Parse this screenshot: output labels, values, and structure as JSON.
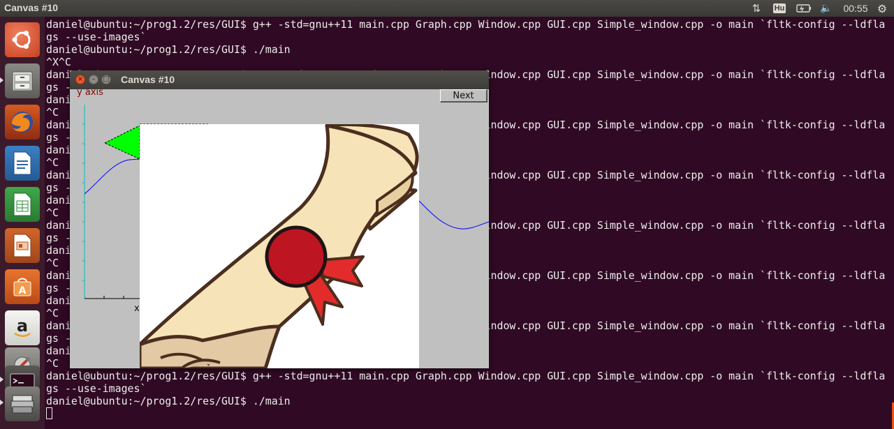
{
  "top_panel": {
    "title": "Canvas #10",
    "keyboard_layout": "Hu",
    "clock": "00:55",
    "icons": [
      "network-icon",
      "keyboard-layout-icon",
      "battery-icon",
      "volume-icon",
      "settings-gear-icon"
    ]
  },
  "launcher": {
    "items": [
      {
        "name": "ubuntu-dash",
        "icon": "ubuntu-logo-icon"
      },
      {
        "name": "files",
        "icon": "file-cabinet-icon"
      },
      {
        "name": "firefox",
        "icon": "firefox-icon"
      },
      {
        "name": "libreoffice-writer",
        "icon": "writer-document-icon"
      },
      {
        "name": "libreoffice-calc",
        "icon": "calc-spreadsheet-icon"
      },
      {
        "name": "libreoffice-impress",
        "icon": "impress-presentation-icon"
      },
      {
        "name": "ubuntu-software",
        "icon": "software-center-icon"
      },
      {
        "name": "amazon",
        "icon": "amazon-icon"
      },
      {
        "name": "system-settings",
        "icon": "settings-wrench-icon"
      },
      {
        "name": "terminal",
        "icon": "terminal-icon"
      },
      {
        "name": "fltk-app",
        "icon": "app-stack-icon"
      }
    ]
  },
  "terminal": {
    "lines": [
      "daniel@ubuntu:~/prog1.2/res/GUI$ g++ -std=gnu++11 main.cpp Graph.cpp Window.cpp GUI.cpp Simple_window.cpp -o main `fltk-config --ldfla",
      "gs --use-images`",
      "daniel@ubuntu:~/prog1.2/res/GUI$ ./main",
      "^X^C",
      "daniel@ubuntu:~/prog1.2/res/GUI$ g++ -std=gnu++11 main.cpp Graph.cpp Window.cpp GUI.cpp Simple_window.cpp -o main `fltk-config --ldfla",
      "gs --use-images`",
      "daniel@ubuntu:~/prog1.2/res/GUI$ ./main",
      "^C",
      "daniel@ubuntu:~/prog1.2/res/GUI$ g++ -std=gnu++11 main.cpp Graph.cpp Window.cpp GUI.cpp Simple_window.cpp -o main `fltk-config --ldfla",
      "gs --use-images`",
      "daniel@ubuntu:~/prog1.2/res/GUI$ ./main",
      "^C",
      "daniel@ubuntu:~/prog1.2/res/GUI$ g++ -std=gnu++11 main.cpp Graph.cpp Window.cpp GUI.cpp Simple_window.cpp -o main `fltk-config --ldfla",
      "gs --use-images`",
      "daniel@ubuntu:~/prog1.2/res/GUI$ ./main",
      "^C",
      "daniel@ubuntu:~/prog1.2/res/GUI$ g++ -std=gnu++11 main.cpp Graph.cpp Window.cpp GUI.cpp Simple_window.cpp -o main `fltk-config --ldfla",
      "gs --use-images`",
      "daniel@ubuntu:~/prog1.2/res/GUI$ ./main",
      "^C",
      "daniel@ubuntu:~/prog1.2/res/GUI$ g++ -std=gnu++11 main.cpp Graph.cpp Window.cpp GUI.cpp Simple_window.cpp -o main `fltk-config --ldfla",
      "gs --use-images`",
      "daniel@ubuntu:~/prog1.2/res/GUI$ ./main",
      "^C",
      "daniel@ubuntu:~/prog1.2/res/GUI$ g++ -std=gnu++11 main.cpp Graph.cpp Window.cpp GUI.cpp Simple_window.cpp -o main `fltk-config --ldfla",
      "gs --use-images`",
      "daniel@ubuntu:~/prog1.2/res/GUI$ ./main",
      "^C",
      "daniel@ubuntu:~/prog1.2/res/GUI$ g++ -std=gnu++11 main.cpp Graph.cpp Window.cpp GUI.cpp Simple_window.cpp -o main `fltk-config --ldfla",
      "gs --use-images`",
      "daniel@ubuntu:~/prog1.2/res/GUI$ ./main"
    ]
  },
  "fltk_window": {
    "title": "Canvas #10",
    "next_label": "Next",
    "y_axis_label": "y axis",
    "x_axis_label": "x"
  },
  "colors": {
    "terminal_bg": "#300a24",
    "terminal_fg": "#eeeeec",
    "axis_color": "#00bfbf",
    "curve_color": "#0000ff",
    "triangle_fill": "#00ff00",
    "scroll_fill": "#f7e3b8",
    "seal_red": "#bd1522",
    "ribbon_red": "#e32b2b"
  }
}
